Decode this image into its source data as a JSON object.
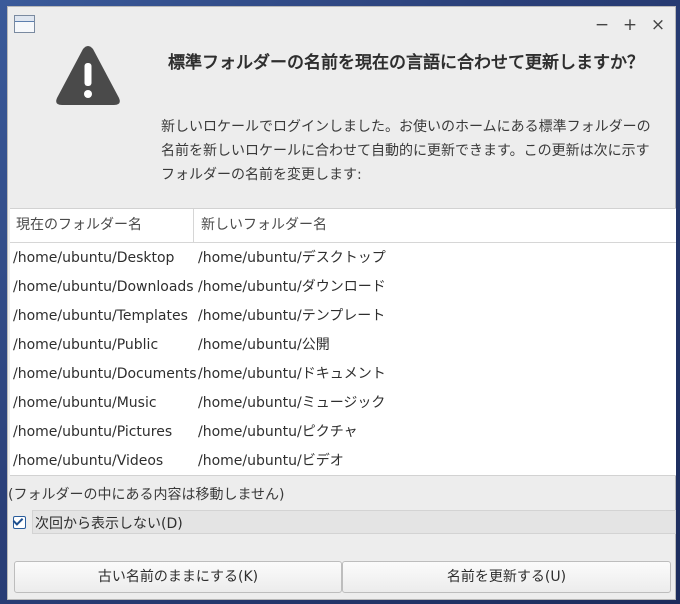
{
  "window": {
    "controls": [
      "−",
      "+",
      "×"
    ]
  },
  "dialog": {
    "heading": "標準フォルダーの名前を現在の言語に合わせて更新しますか？",
    "message": "新しいロケールでログインしました。お使いのホームにある標準フォルダーの名前を新しいロケールに合わせて自動的に更新できます。この更新は次に示すフォルダーの名前を変更します:"
  },
  "table": {
    "headers": {
      "old": "現在のフォルダー名",
      "new": "新しいフォルダー名"
    },
    "rows": [
      {
        "old": "/home/ubuntu/Desktop",
        "new": "/home/ubuntu/デスクトップ"
      },
      {
        "old": "/home/ubuntu/Downloads",
        "new": "/home/ubuntu/ダウンロード"
      },
      {
        "old": "/home/ubuntu/Templates",
        "new": "/home/ubuntu/テンプレート"
      },
      {
        "old": "/home/ubuntu/Public",
        "new": "/home/ubuntu/公開"
      },
      {
        "old": "/home/ubuntu/Documents",
        "new": "/home/ubuntu/ドキュメント"
      },
      {
        "old": "/home/ubuntu/Music",
        "new": "/home/ubuntu/ミュージック"
      },
      {
        "old": "/home/ubuntu/Pictures",
        "new": "/home/ubuntu/ピクチャ"
      },
      {
        "old": "/home/ubuntu/Videos",
        "new": "/home/ubuntu/ビデオ"
      }
    ]
  },
  "note": "(フォルダーの中にある内容は移動しません)",
  "checkbox": {
    "label": "次回から表示しない(D)",
    "checked": true
  },
  "buttons": {
    "keep": "古い名前のままにする(K)",
    "update": "名前を更新する(U)"
  },
  "icons": {
    "app": "window-icon",
    "warning": "warning-icon"
  },
  "colors": {
    "warning_icon": "#4a4a4a",
    "checkbox_accent": "#1d4f8f"
  }
}
